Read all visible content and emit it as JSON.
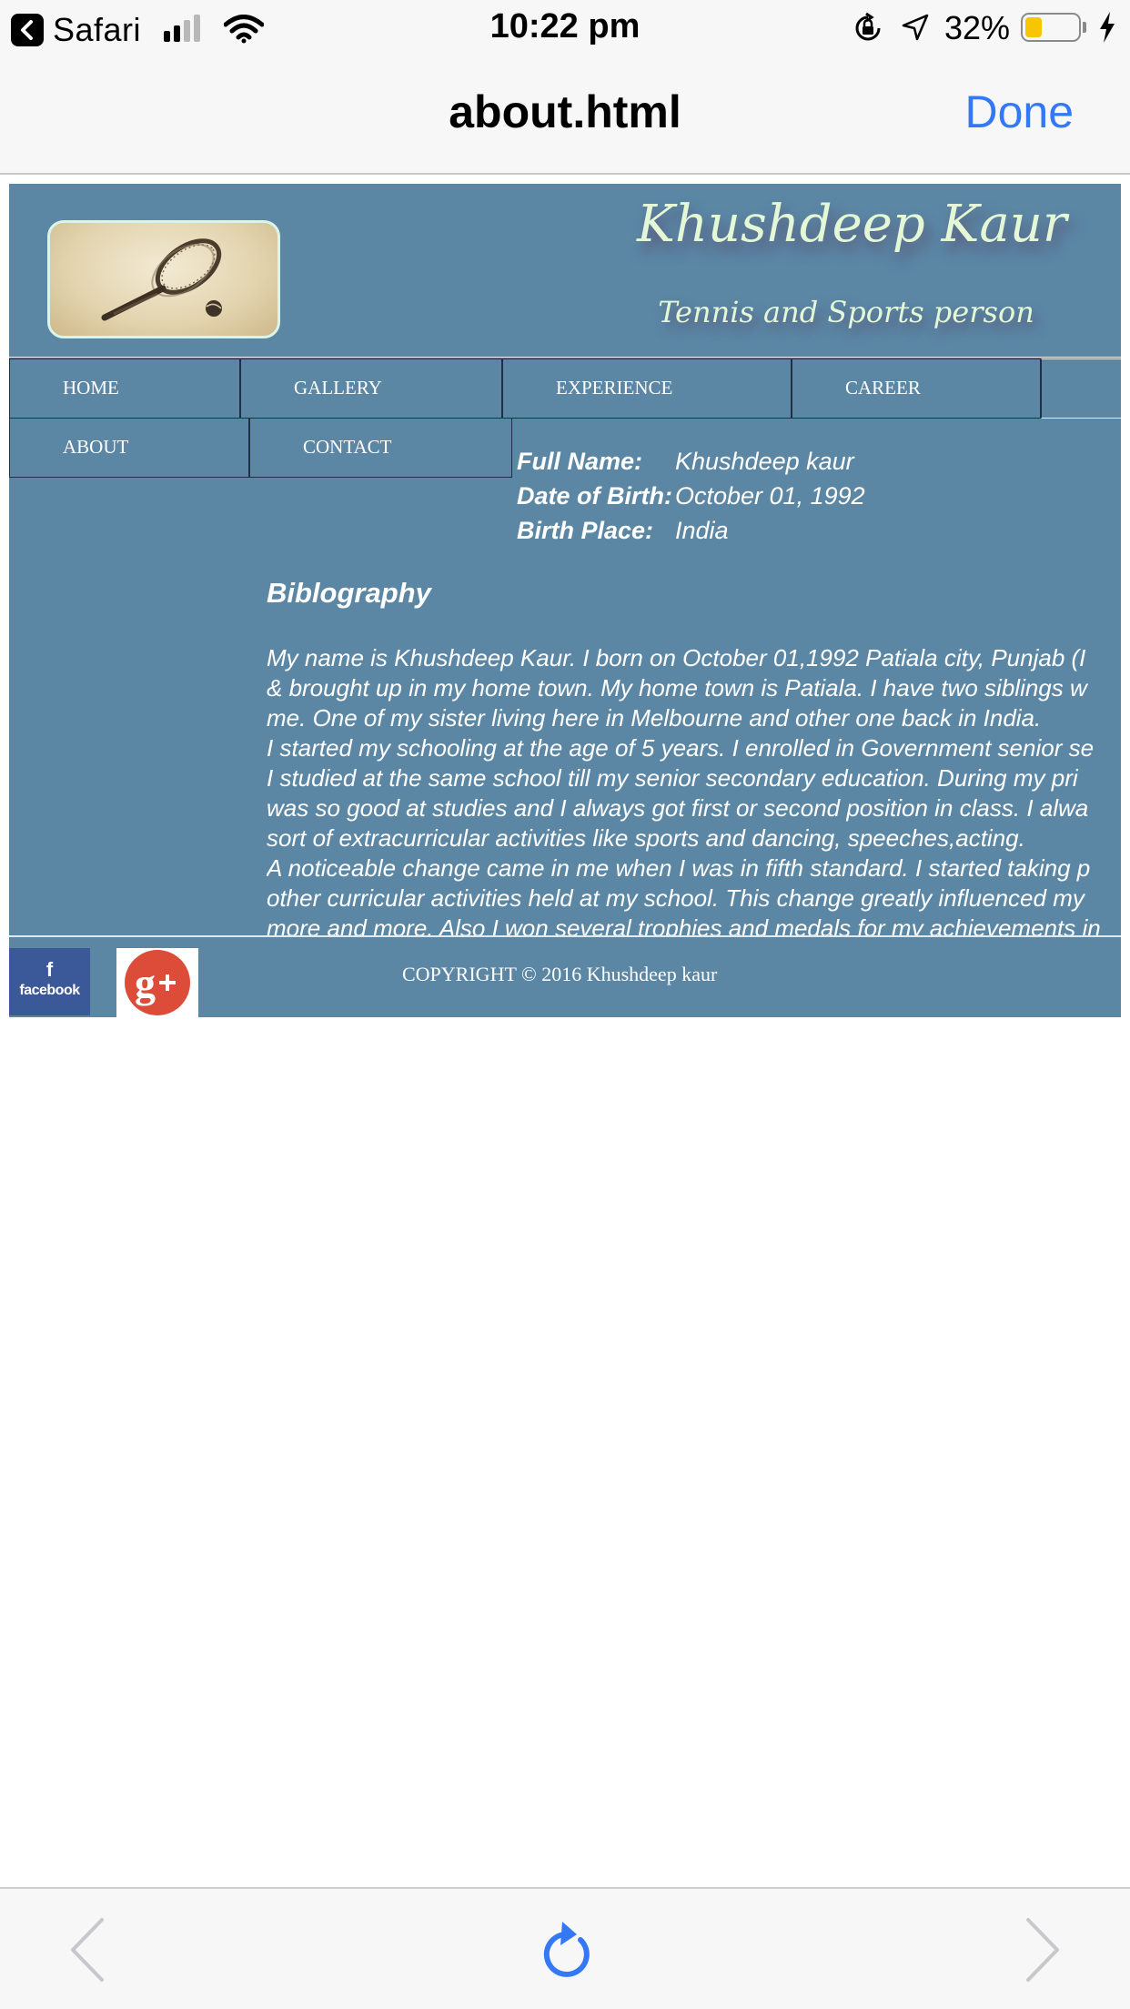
{
  "status_bar": {
    "back_app": "Safari",
    "time": "10:22 pm",
    "battery_percent": "32%",
    "battery_level": 0.32,
    "signal_bars_active": 2,
    "signal_bars_total": 4
  },
  "nav_bar": {
    "title": "about.html",
    "done_label": "Done",
    "accent_color": "#3478f6"
  },
  "site": {
    "title": "Khushdeep Kaur",
    "subtitle": "Tennis and Sports person",
    "background_color": "#5b87a5",
    "menu": {
      "home": "HOME",
      "gallery": "GALLERY",
      "experience": "EXPERIENCE",
      "career": "CAREER",
      "about": "ABOUT",
      "contact": "CONTACT"
    },
    "info": {
      "full_name_label": "Full Name:",
      "full_name": "Khushdeep kaur",
      "dob_label": "Date of Birth:",
      "dob": "October 01, 1992",
      "birth_place_label": "Birth Place:",
      "birth_place": "India"
    },
    "bio": {
      "title": "Biblography",
      "lines": [
        "My name is Khushdeep Kaur. I born on October 01,1992 Patiala city, Punjab (I",
        "& brought up in my home town. My home town is Patiala. I have two siblings w",
        "me. One of my sister living here in Melbourne and other one back in India.",
        "I started my schooling at the age of 5 years. I enrolled in Government senior se",
        "I studied at the same school till my senior secondary education. During my pri",
        "was so good at studies and I always got first or second position in class. I alwa",
        "sort of extracurricular activities like sports and dancing, speeches,acting.",
        "A noticeable change came in me when I was in fifth standard. I started taking p",
        "other curricular activities held at my school. This change greatly influenced my",
        "more and more. Also I won several trophies and medals for my achievements in"
      ]
    },
    "footer": {
      "facebook_label": "facebook",
      "copyright": "COPYRIGHT © 2016 Khushdeep kaur"
    }
  },
  "toolbar": {
    "back_icon": "chevron-left-icon",
    "reload_icon": "reload-icon",
    "forward_icon": "chevron-right-icon"
  }
}
